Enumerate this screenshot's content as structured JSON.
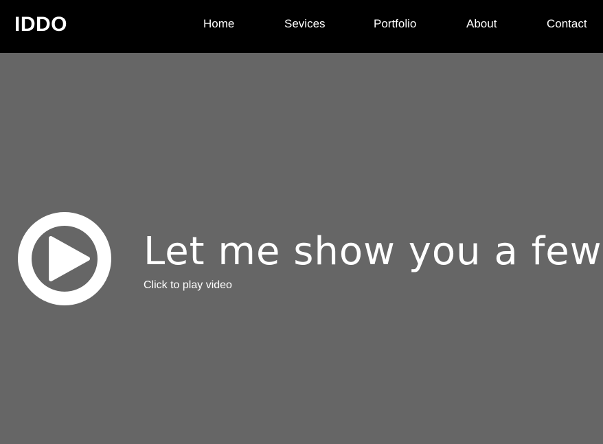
{
  "header": {
    "logo": "IDDO",
    "nav": {
      "home": "Home",
      "services": "Sevices",
      "portfolio": "Portfolio",
      "about": "About",
      "contact": "Contact"
    }
  },
  "hero": {
    "headline": "Let me show you a few th",
    "subtext": "Click to play video",
    "play_icon": "play-circle-icon"
  },
  "colors": {
    "header_background": "#000000",
    "hero_background": "#666666",
    "text": "#ffffff"
  }
}
